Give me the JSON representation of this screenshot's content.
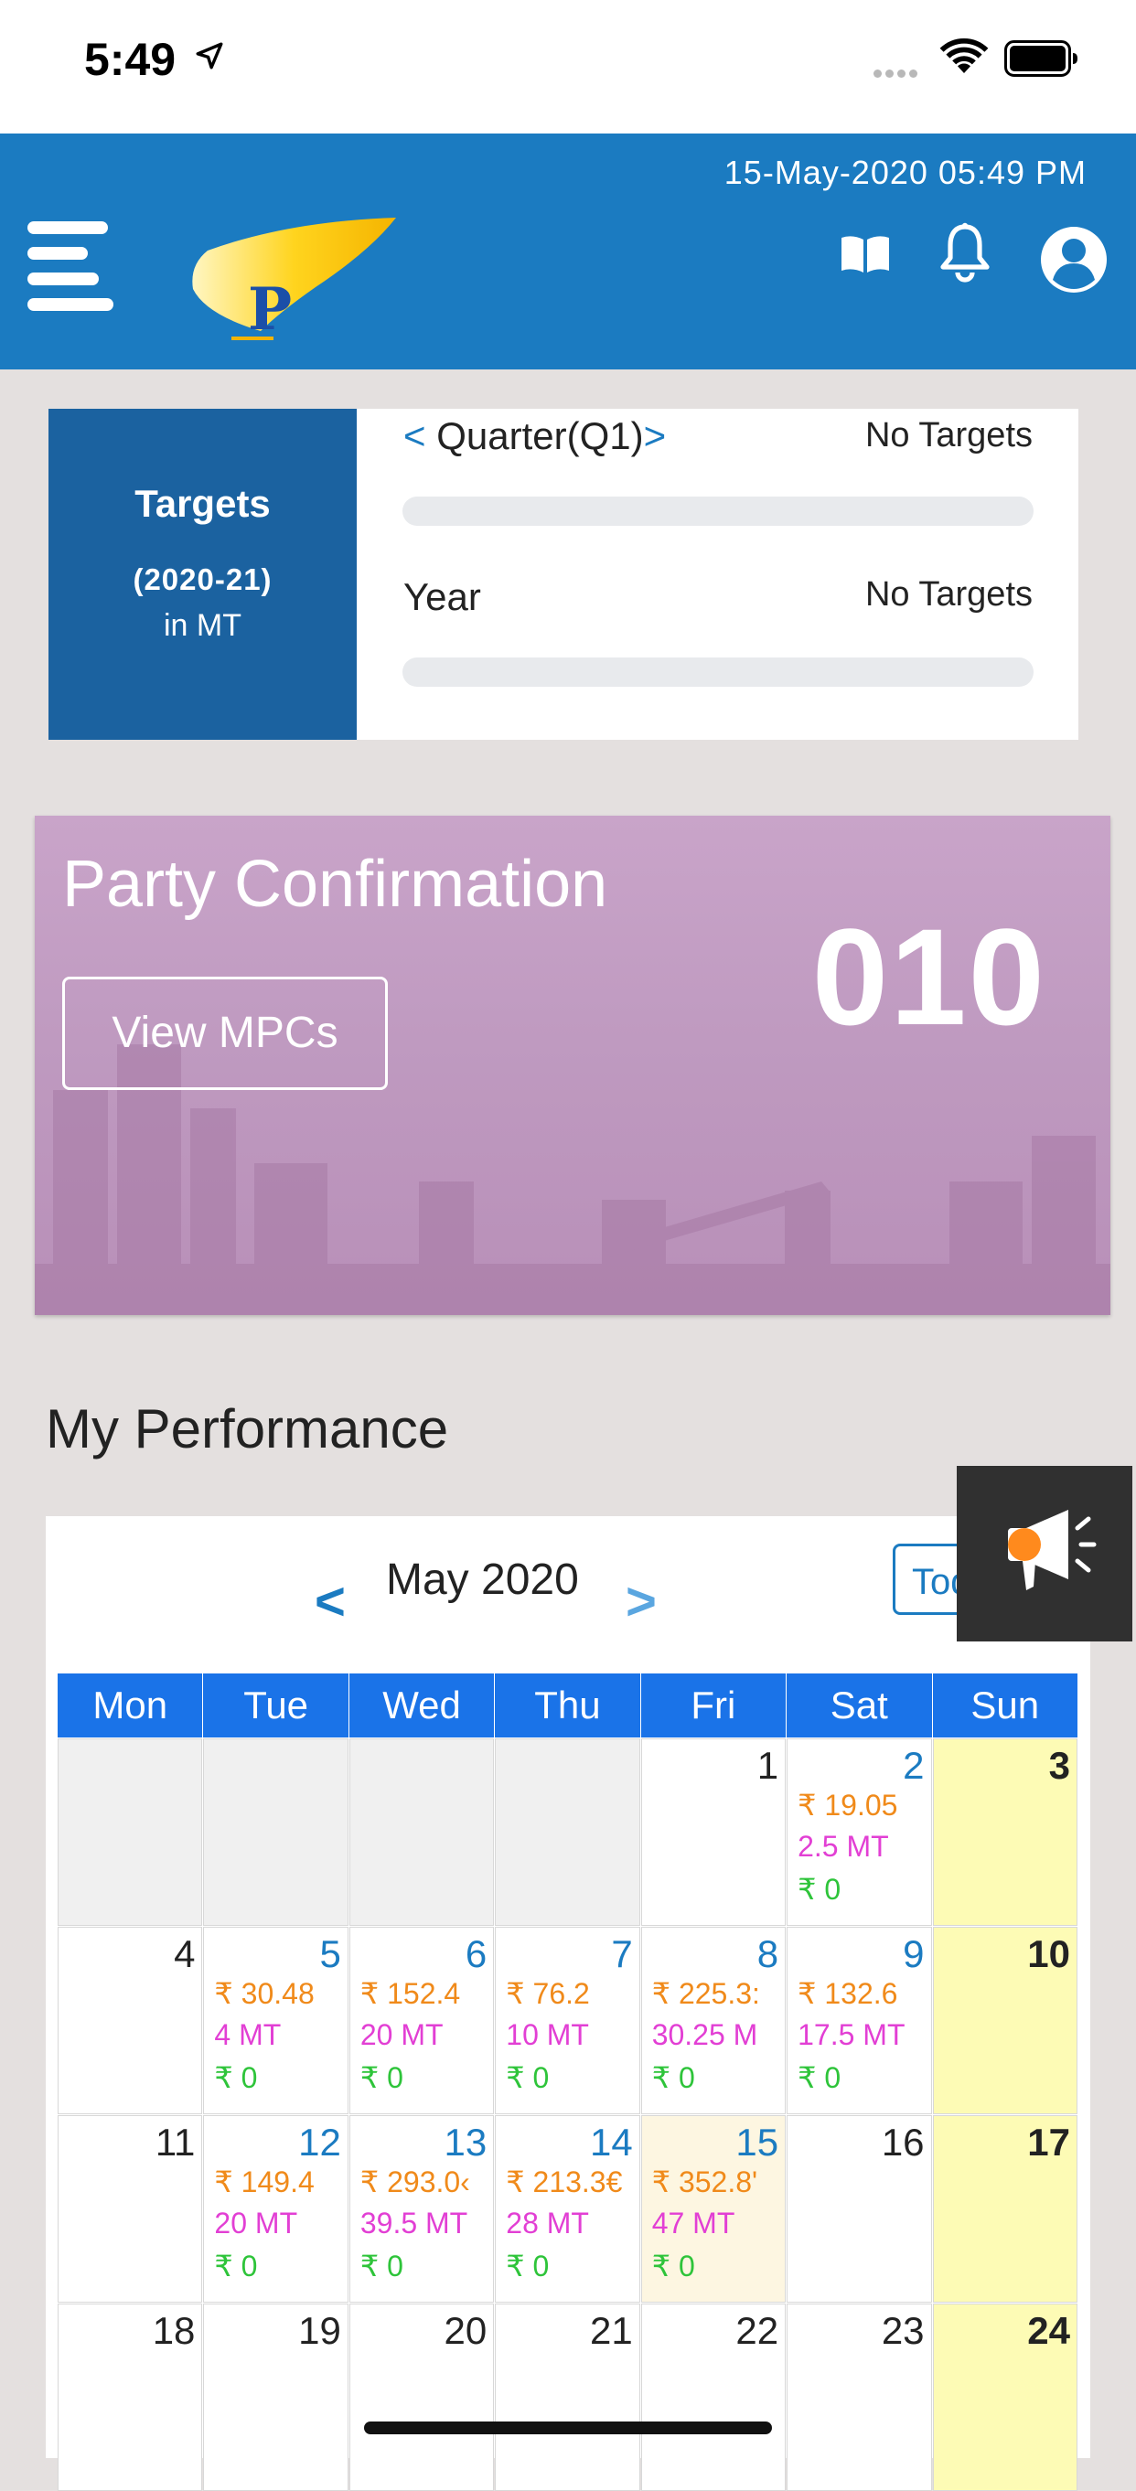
{
  "status_bar": {
    "time": "5:49"
  },
  "header": {
    "datetime": "15-May-2020 05:49 PM",
    "logo_letter": "P",
    "icons": [
      "menu-icon",
      "book-icon",
      "bell-icon",
      "user-icon"
    ]
  },
  "targets": {
    "title": "Targets",
    "year": "(2020-21)",
    "unit": "in MT",
    "quarter": {
      "prev": "<",
      "label": "Quarter(Q1)",
      "next": ">",
      "value": "No Targets",
      "progress": 0
    },
    "year_row": {
      "label": "Year",
      "value": "No Targets",
      "progress": 0
    }
  },
  "party": {
    "title": "Party Confirmation",
    "count": "010",
    "button": "View MPCs"
  },
  "performance": {
    "title": "My Performance",
    "calendar": {
      "prev": "<",
      "month": "May 2020",
      "next": ">",
      "today_button": "Today",
      "dow": [
        "Mon",
        "Tue",
        "Wed",
        "Thu",
        "Fri",
        "Sat",
        "Sun"
      ],
      "weeks": [
        [
          {
            "day": ""
          },
          {
            "day": ""
          },
          {
            "day": ""
          },
          {
            "day": ""
          },
          {
            "day": "1"
          },
          {
            "day": "2",
            "amt": "₹ 19.05",
            "qty": "2.5 MT",
            "rec": "₹ 0"
          },
          {
            "day": "3"
          }
        ],
        [
          {
            "day": "4"
          },
          {
            "day": "5",
            "amt": "₹ 30.48",
            "qty": "4 MT",
            "rec": "₹ 0"
          },
          {
            "day": "6",
            "amt": "₹ 152.4",
            "qty": "20 MT",
            "rec": "₹ 0"
          },
          {
            "day": "7",
            "amt": "₹ 76.2",
            "qty": "10 MT",
            "rec": "₹ 0"
          },
          {
            "day": "8",
            "amt": "₹ 225.3:",
            "qty": "30.25 M",
            "rec": "₹ 0"
          },
          {
            "day": "9",
            "amt": "₹ 132.6",
            "qty": "17.5 MT",
            "rec": "₹ 0"
          },
          {
            "day": "10"
          }
        ],
        [
          {
            "day": "11"
          },
          {
            "day": "12",
            "amt": "₹ 149.4",
            "qty": "20 MT",
            "rec": "₹ 0"
          },
          {
            "day": "13",
            "amt": "₹ 293.0‹",
            "qty": "39.5 MT",
            "rec": "₹ 0"
          },
          {
            "day": "14",
            "amt": "₹ 213.3€",
            "qty": "28 MT",
            "rec": "₹ 0"
          },
          {
            "day": "15",
            "amt": "₹ 352.8'",
            "qty": "47 MT",
            "rec": "₹ 0"
          },
          {
            "day": "16"
          },
          {
            "day": "17"
          }
        ],
        [
          {
            "day": "18"
          },
          {
            "day": "19"
          },
          {
            "day": "20"
          },
          {
            "day": "21"
          },
          {
            "day": "22"
          },
          {
            "day": "23"
          },
          {
            "day": "24"
          }
        ]
      ]
    }
  },
  "colors": {
    "header_blue": "#1b7bc1",
    "targets_blue": "#1b62a0",
    "calendar_header": "#1a73e8",
    "amount": "#f08a1a",
    "quantity": "#e23fd4",
    "received": "#2ec43a",
    "sunday": "#fdfbb5",
    "today": "#fdf6e1"
  }
}
